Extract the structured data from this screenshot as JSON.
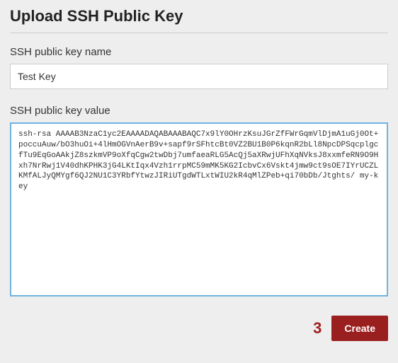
{
  "header": {
    "title": "Upload SSH Public Key"
  },
  "fields": {
    "keyName": {
      "label": "SSH public key name",
      "value": "Test Key"
    },
    "keyValue": {
      "label": "SSH public key value",
      "value": "ssh-rsa AAAAB3NzaC1yc2EAAAADAQABAAABAQC7x9lY0OHrzKsuJGrZfFWrGqmVlDjmA1uGj0Ot+poccuAuw/bO3huOi+4lHmOGVnAerB9v+sapf9rSFhtcBt0VZ2BU1B0P6kqnR2bLl8NpcDPSqcplgcfTu9EqGoAAkjZ8szkmVP9oXfqCgw2twDbj7umfaeaRLG5AcQj5aXRwjUFhXqNVksJ8xxmfeRN9O9Hxh7NrRwj1V40dhKPHK3jG4LKtIqx4Vzh1rrpMC59mMK5KG2IcbvCx6Vskt4jmw9ct9sOE7IYrUCZLKMfALJyQMYgf6QJ2NU1C3YRbfYtwzJIRiUTgdWTLxtWIU2kR4qMlZPeb+qi70bDb/Jtghts/ my-key"
    }
  },
  "footer": {
    "stepNumber": "3",
    "createLabel": "Create"
  }
}
